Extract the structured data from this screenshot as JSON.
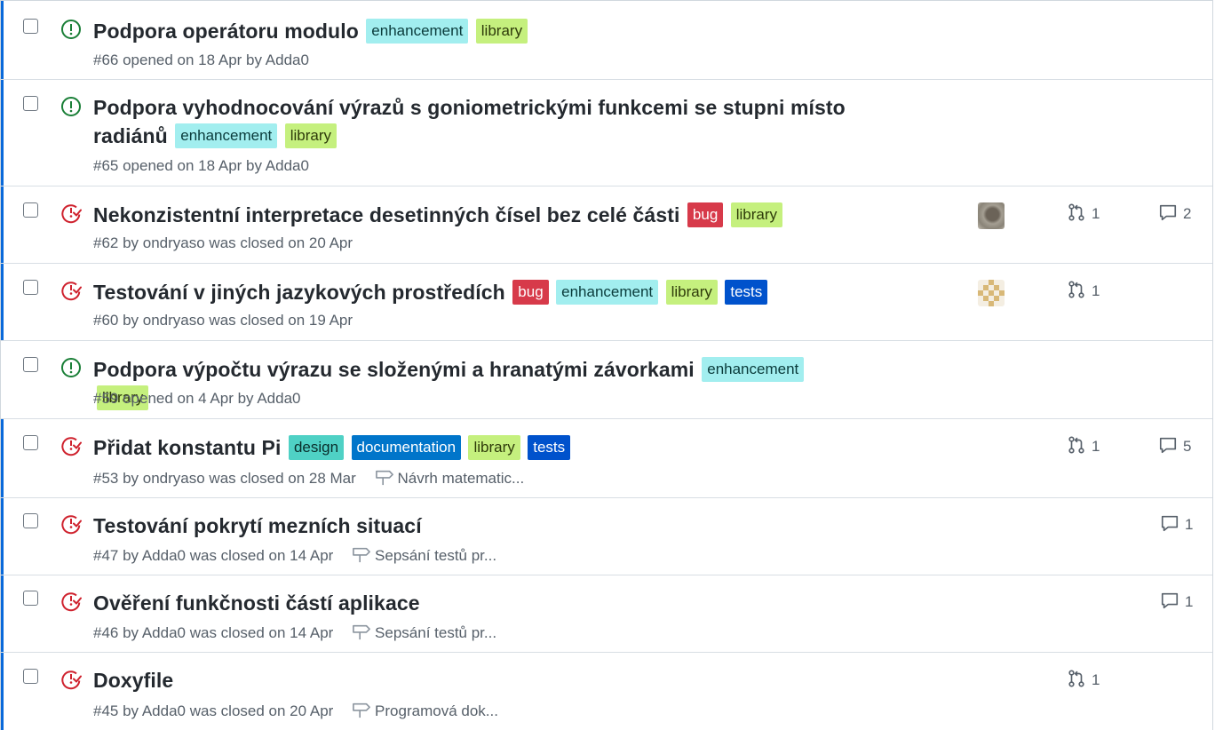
{
  "colors": {
    "open": "#1a7f37",
    "closed": "#cf222e",
    "unread_bar": "#0969da",
    "label_enhancement": "#a2eeef",
    "label_library": "#c5f07e",
    "label_bug": "#d73a4a",
    "label_tests": "#0052cc",
    "label_design": "#4fd1c5",
    "label_documentation": "#0075ca"
  },
  "issues": [
    {
      "state": "open",
      "title": "Podpora operátoru modulo",
      "labels": [
        "enhancement",
        "library"
      ],
      "meta": "#66 opened on 18 Apr by Adda0"
    },
    {
      "state": "open",
      "title_line1": "Podpora vyhodnocování výrazů s goniometrickými funkcemi se stupni místo",
      "title_line2": "radiánů",
      "labels": [
        "enhancement",
        "library"
      ],
      "meta": "#65 opened on 18 Apr by Adda0"
    },
    {
      "state": "closed",
      "title": "Nekonzistentní interpretace desetinných čísel bez celé části",
      "labels": [
        "bug",
        "library"
      ],
      "meta": "#62 by ondryaso was closed on 20 Apr",
      "avatar": "avatar-photo",
      "linked_prs": "1",
      "comments": "2"
    },
    {
      "state": "closed",
      "title": "Testování v jiných jazykových prostředích",
      "labels": [
        "bug",
        "enhancement",
        "library",
        "tests"
      ],
      "meta": "#60 by ondryaso was closed on 19 Apr",
      "avatar": "avatar-identicon",
      "linked_prs": "1"
    },
    {
      "state": "open",
      "title": "Podpora výpočtu výrazu se složenými a hranatými závorkami",
      "labels": [
        "enhancement",
        "library"
      ],
      "meta": "#59 opened on 4 Apr by Adda0"
    },
    {
      "state": "closed",
      "title": "Přidat konstantu Pi",
      "labels": [
        "design",
        "documentation",
        "library",
        "tests"
      ],
      "meta": "#53 by ondryaso was closed on 28 Mar",
      "milestone": "Návrh matematic...",
      "linked_prs": "1",
      "comments": "5"
    },
    {
      "state": "closed",
      "title": "Testování pokrytí mezních situací",
      "meta": "#47 by Adda0 was closed on 14 Apr",
      "milestone": "Sepsání testů pr...",
      "comments": "1"
    },
    {
      "state": "closed",
      "title": "Ověření funkčnosti částí aplikace",
      "meta": "#46 by Adda0 was closed on 14 Apr",
      "milestone": "Sepsání testů pr...",
      "comments": "1"
    },
    {
      "state": "closed",
      "title": "Doxyfile",
      "meta": "#45 by Adda0 was closed on 20 Apr",
      "milestone": "Programová dok...",
      "linked_prs": "1"
    }
  ]
}
